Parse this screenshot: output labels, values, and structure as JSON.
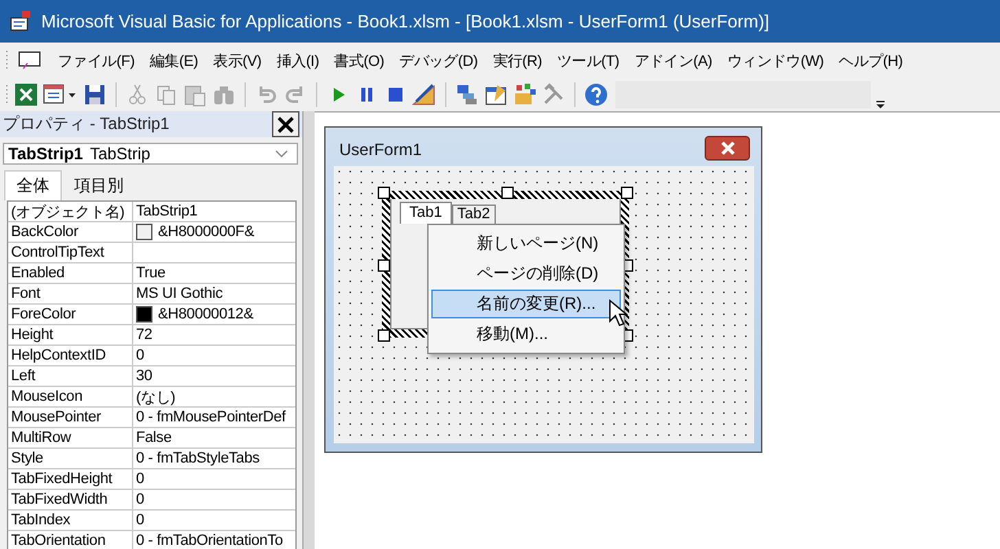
{
  "window": {
    "title": "Microsoft Visual Basic for Applications - Book1.xlsm - [Book1.xlsm - UserForm1 (UserForm)]"
  },
  "menu": [
    "ファイル(F)",
    "編集(E)",
    "表示(V)",
    "挿入(I)",
    "書式(O)",
    "デバッグ(D)",
    "実行(R)",
    "ツール(T)",
    "アドイン(A)",
    "ウィンドウ(W)",
    "ヘルプ(H)"
  ],
  "properties": {
    "title": "プロパティ - TabStrip1",
    "object_name": "TabStrip1",
    "object_type": "TabStrip",
    "tabs": [
      {
        "label": "全体",
        "selected": true
      },
      {
        "label": "項目別",
        "selected": false
      }
    ],
    "rows": [
      {
        "name": "(オブジェクト名)",
        "value": "TabStrip1"
      },
      {
        "name": "BackColor",
        "value": "&H8000000F&",
        "color": "#f0f0f0"
      },
      {
        "name": "ControlTipText",
        "value": ""
      },
      {
        "name": "Enabled",
        "value": "True"
      },
      {
        "name": "Font",
        "value": "MS UI Gothic"
      },
      {
        "name": "ForeColor",
        "value": "&H80000012&",
        "color": "#000000"
      },
      {
        "name": "Height",
        "value": "72"
      },
      {
        "name": "HelpContextID",
        "value": "0"
      },
      {
        "name": "Left",
        "value": "30"
      },
      {
        "name": "MouseIcon",
        "value": "(なし)"
      },
      {
        "name": "MousePointer",
        "value": "0 - fmMousePointerDef"
      },
      {
        "name": "MultiRow",
        "value": "False"
      },
      {
        "name": "Style",
        "value": "0 - fmTabStyleTabs"
      },
      {
        "name": "TabFixedHeight",
        "value": "0"
      },
      {
        "name": "TabFixedWidth",
        "value": "0"
      },
      {
        "name": "TabIndex",
        "value": "0"
      },
      {
        "name": "TabOrientation",
        "value": "0 - fmTabOrientationTo"
      }
    ]
  },
  "userform": {
    "title": "UserForm1",
    "tabs": [
      {
        "label": "Tab1",
        "selected": true
      },
      {
        "label": "Tab2",
        "selected": false
      }
    ]
  },
  "context_menu": [
    {
      "label": "新しいページ(N)",
      "selected": false
    },
    {
      "label": "ページの削除(D)",
      "selected": false
    },
    {
      "label": "名前の変更(R)...",
      "selected": true
    },
    {
      "label": "移動(M)...",
      "selected": false
    }
  ]
}
